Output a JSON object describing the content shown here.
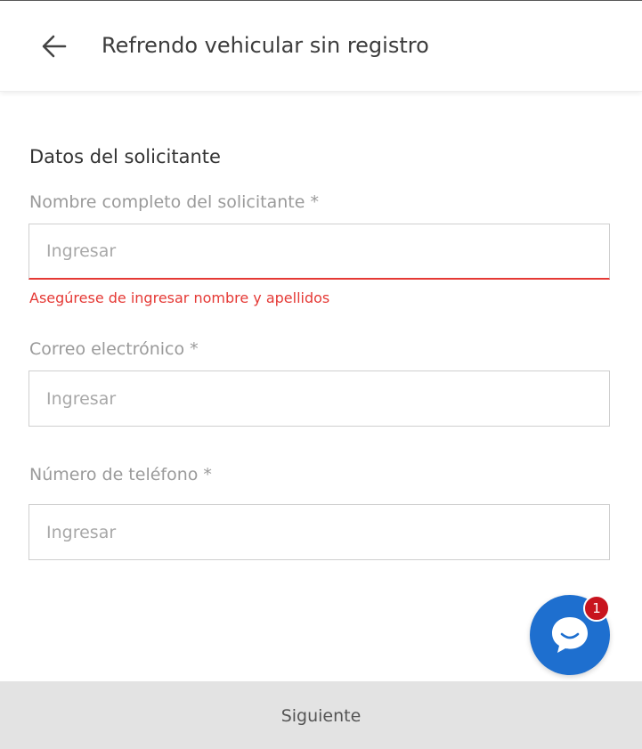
{
  "header": {
    "title": "Refrendo vehicular sin registro",
    "back_icon": "arrow-left-icon"
  },
  "form": {
    "section_title": "Datos del solicitante",
    "fields": [
      {
        "label": "Nombre completo del solicitante *",
        "placeholder": "Ingresar",
        "value": "",
        "error": "Asegúrese de ingresar nombre y apellidos"
      },
      {
        "label": "Correo electrónico *",
        "placeholder": "Ingresar",
        "value": ""
      },
      {
        "label": "Número de teléfono *",
        "placeholder": "Ingresar",
        "value": ""
      }
    ]
  },
  "chat": {
    "icon": "chat-bubble-icon",
    "badge_count": "1",
    "color": "#1e6fcf",
    "badge_color": "#c8141e"
  },
  "footer": {
    "next_label": "Siguiente"
  },
  "colors": {
    "error": "#e53935",
    "footer_bg": "#e3e3e3"
  }
}
